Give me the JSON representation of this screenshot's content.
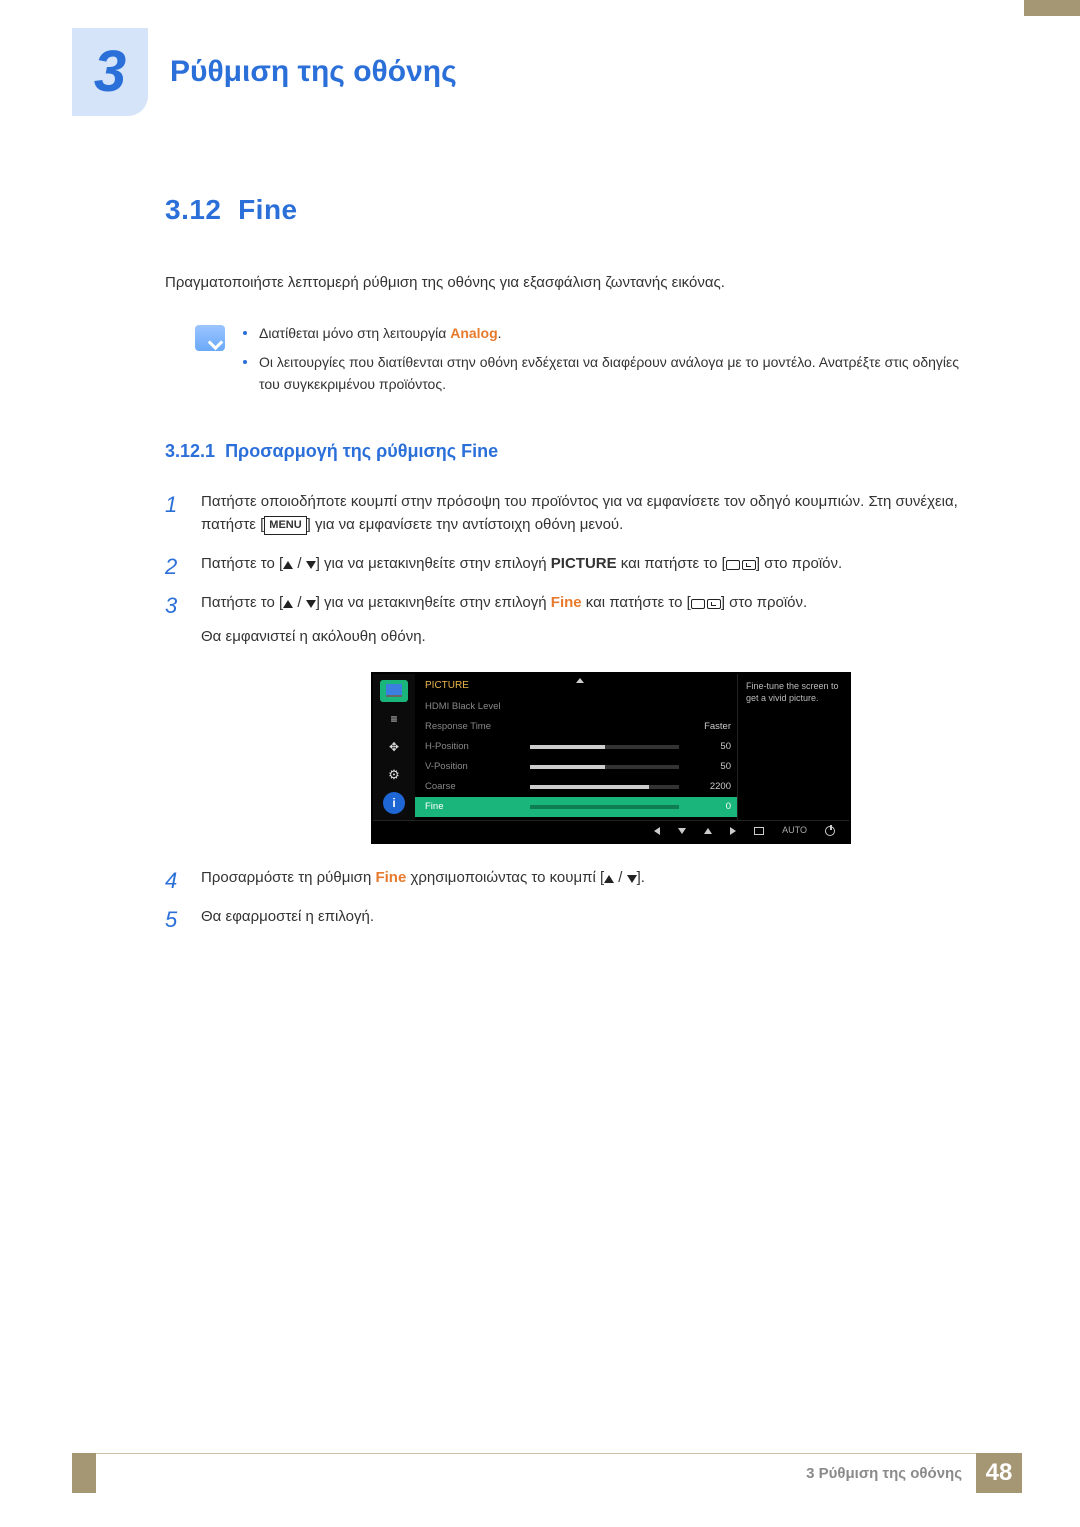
{
  "chapter": {
    "number": "3",
    "title": "Ρύθμιση της οθόνης"
  },
  "section": {
    "number": "3.12",
    "title": "Fine"
  },
  "intro": "Πραγματοποιήστε λεπτομερή ρύθμιση της οθόνης για εξασφάλιση ζωντανής εικόνας.",
  "notes": {
    "line1_pre": "Διατίθεται μόνο στη λειτουργία ",
    "line1_accent": "Analog",
    "line1_post": ".",
    "line2": "Οι λειτουργίες που διατίθενται στην οθόνη ενδέχεται να διαφέρουν ανάλογα με το μοντέλο. Ανατρέξτε στις οδηγίες του συγκεκριμένου προϊόντος."
  },
  "subsection": {
    "number": "3.12.1",
    "title": "Προσαρμογή της ρύθμισης Fine"
  },
  "steps": {
    "s1a": "Πατήστε οποιοδήποτε κουμπί στην πρόσοψη του προϊόντος για να εμφανίσετε τον οδηγό κουμπιών. Στη συνέχεια, πατήστε [",
    "s1_menu": "MENU",
    "s1b": "] για να εμφανίσετε την αντίστοιχη οθόνη μενού.",
    "s2a": "Πατήστε το [",
    "s2b": "] για να μετακινηθείτε στην επιλογή ",
    "s2_pic": "PICTURE",
    "s2c": " και πατήστε το [",
    "s2d": "] στο προϊόν.",
    "s3a": "Πατήστε το [",
    "s3b": "] για να μετακινηθείτε στην επιλογή ",
    "s3_fine": "Fine",
    "s3c": " και πατήστε το [",
    "s3d": "] στο προϊόν.",
    "s3e": "Θα εμφανιστεί η ακόλουθη οθόνη.",
    "s4a": "Προσαρμόστε τη ρύθμιση ",
    "s4_fine": "Fine",
    "s4b": " χρησιμοποιώντας το κουμπί [",
    "s4c": "].",
    "s5": "Θα εφαρμοστεί η επιλογή."
  },
  "osd": {
    "title": "PICTURE",
    "desc": "Fine-tune the screen to get a vivid picture.",
    "rows": [
      {
        "name": "HDMI Black Level",
        "val": "",
        "pct": 0,
        "bar": false
      },
      {
        "name": "Response Time",
        "val": "Faster",
        "pct": 0,
        "bar": false
      },
      {
        "name": "H-Position",
        "val": "50",
        "pct": 50,
        "bar": true
      },
      {
        "name": "V-Position",
        "val": "50",
        "pct": 50,
        "bar": true
      },
      {
        "name": "Coarse",
        "val": "2200",
        "pct": 80,
        "bar": true
      },
      {
        "name": "Fine",
        "val": "0",
        "pct": 0,
        "bar": true,
        "hl": true
      }
    ],
    "footer_auto": "AUTO"
  },
  "footer": {
    "text": "3 Ρύθμιση της οθόνης",
    "page": "48"
  }
}
